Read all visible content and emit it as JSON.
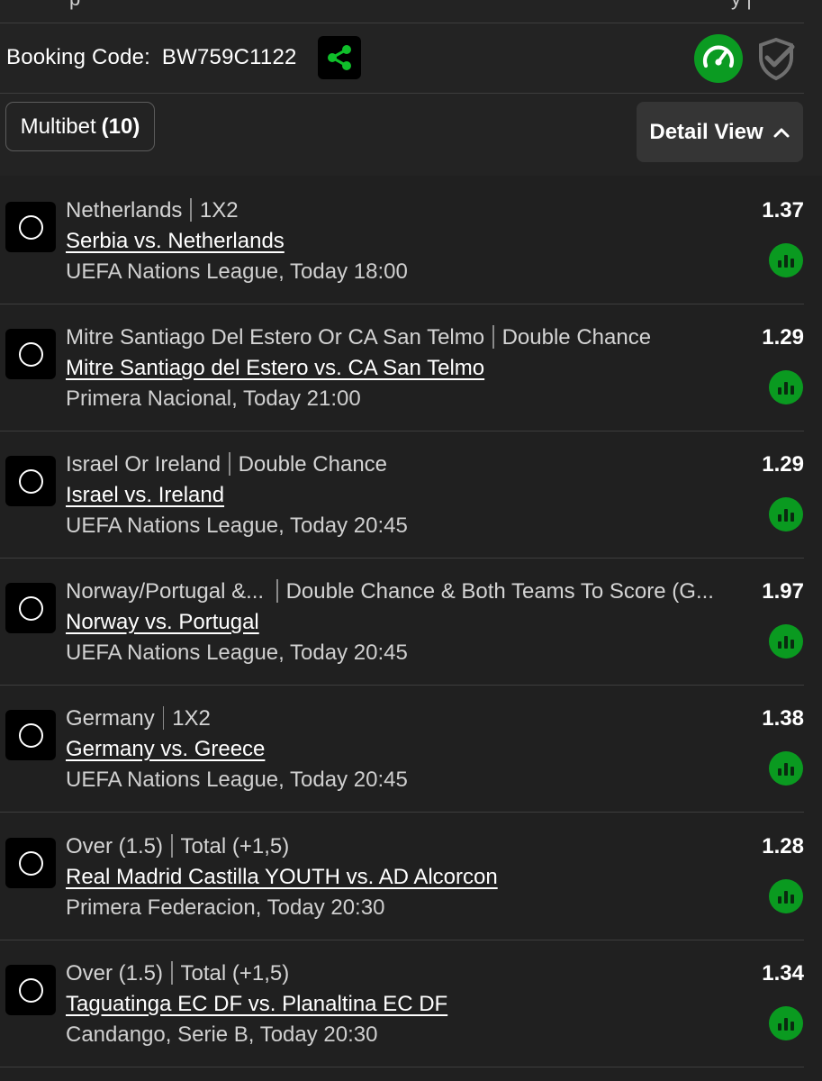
{
  "header": {
    "booking_label": "Booking Code:",
    "booking_code": "BW759C1122",
    "icons": [
      "share-icon",
      "speedometer-icon",
      "shield-check-icon"
    ],
    "accent_color": "#0b9b22"
  },
  "toolbar": {
    "multibet_label": "Multibet",
    "multibet_count": "(10)",
    "detail_view_label": "Detail View"
  },
  "bets": [
    {
      "selection": "Netherlands",
      "market": "1X2",
      "match": "Serbia vs. Netherlands",
      "league": "UEFA Nations League, Today 18:00",
      "odds": "1.37"
    },
    {
      "selection": "Mitre Santiago Del Estero Or CA San Telmo",
      "market": "Double Chance",
      "match": "Mitre Santiago del Estero vs. CA San Telmo",
      "league": "Primera Nacional, Today 21:00",
      "odds": "1.29"
    },
    {
      "selection": "Israel Or Ireland",
      "market": "Double Chance",
      "match": "Israel vs. Ireland",
      "league": "UEFA Nations League, Today 20:45",
      "odds": "1.29"
    },
    {
      "selection": "Norway/Portugal &...",
      "market": "Double Chance & Both Teams To Score (G...",
      "match": "Norway vs. Portugal",
      "league": "UEFA Nations League, Today 20:45",
      "odds": "1.97"
    },
    {
      "selection": "Germany",
      "market": "1X2",
      "match": "Germany vs. Greece",
      "league": "UEFA Nations League, Today 20:45",
      "odds": "1.38"
    },
    {
      "selection": "Over (1.5)",
      "market": "Total (+1,5)",
      "match": "Real Madrid Castilla YOUTH vs. AD Alcorcon",
      "league": "Primera Federacion, Today 20:30",
      "odds": "1.28"
    },
    {
      "selection": "Over (1.5)",
      "market": "Total (+1,5)",
      "match": "Taguatinga EC DF vs. Planaltina EC DF",
      "league": "Candango, Serie B, Today 20:30",
      "odds": "1.34"
    }
  ]
}
